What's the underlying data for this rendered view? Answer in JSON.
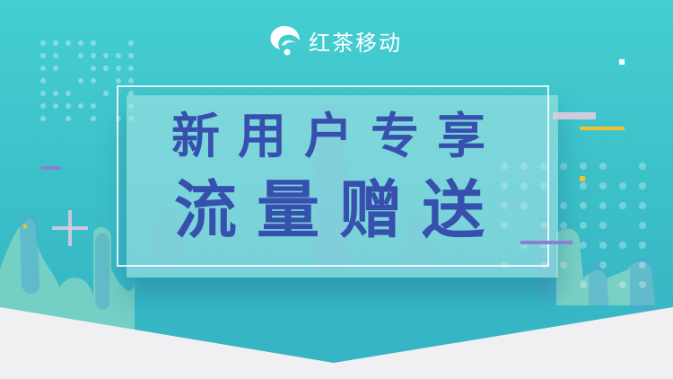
{
  "brand": {
    "logo_icon": "tea-leaf-swirl-icon",
    "name": "红茶移动"
  },
  "headline": {
    "line1": "新用户专享",
    "line2": "流量赠送"
  },
  "colors": {
    "background": "#40c6cc",
    "headline_text": "#3750ae",
    "accent_yellow": "#f2c230",
    "accent_purple": "#8a7fd0",
    "floor": "#f0f0f2"
  }
}
